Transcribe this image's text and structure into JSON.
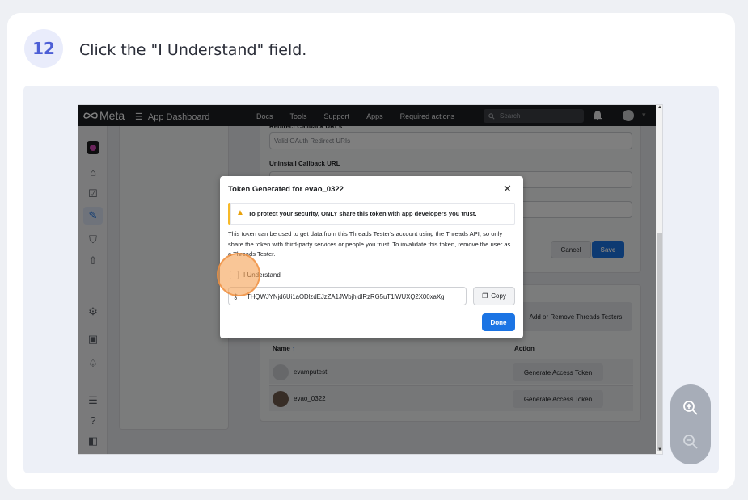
{
  "step": {
    "number": "12",
    "instruction": "Click the \"I Understand\" field."
  },
  "app": {
    "brand": "Meta",
    "menu_label": "App Dashboard",
    "nav": [
      "Docs",
      "Tools",
      "Support",
      "Apps",
      "Required actions"
    ],
    "search_placeholder": "Search"
  },
  "form": {
    "redirect_label": "Redirect Callback URLs",
    "redirect_placeholder": "Valid OAuth Redirect URIs",
    "uninstall_label": "Uninstall Callback URL",
    "cancel": "Cancel",
    "save": "Save"
  },
  "testers": {
    "add_remove": "Add or Remove Threads Testers",
    "col_name": "Name",
    "col_action": "Action",
    "rows": [
      {
        "name": "evamputest",
        "action": "Generate Access Token"
      },
      {
        "name": "evao_0322",
        "action": "Generate Access Token"
      }
    ]
  },
  "modal": {
    "title": "Token Generated for evao_0322",
    "warning": "To protect your security, ONLY share this token with app developers you trust.",
    "description": "This token can be used to get data from this Threads Tester's account using the Threads API, so only share the token with third-party services or people you trust. To invalidate this token, remove the user as a Threads Tester.",
    "checkbox_label": "I Understand",
    "token": "THQWJYNjd6Ui1aODlzdEJzZA1JWbjhjdlRzRG5uT1lWUXQ2X00xaXg",
    "copy": "Copy",
    "done": "Done"
  },
  "colors": {
    "accent": "#1b74e4",
    "step_badge": "#4d5fd6",
    "highlight": "#f5a052"
  }
}
